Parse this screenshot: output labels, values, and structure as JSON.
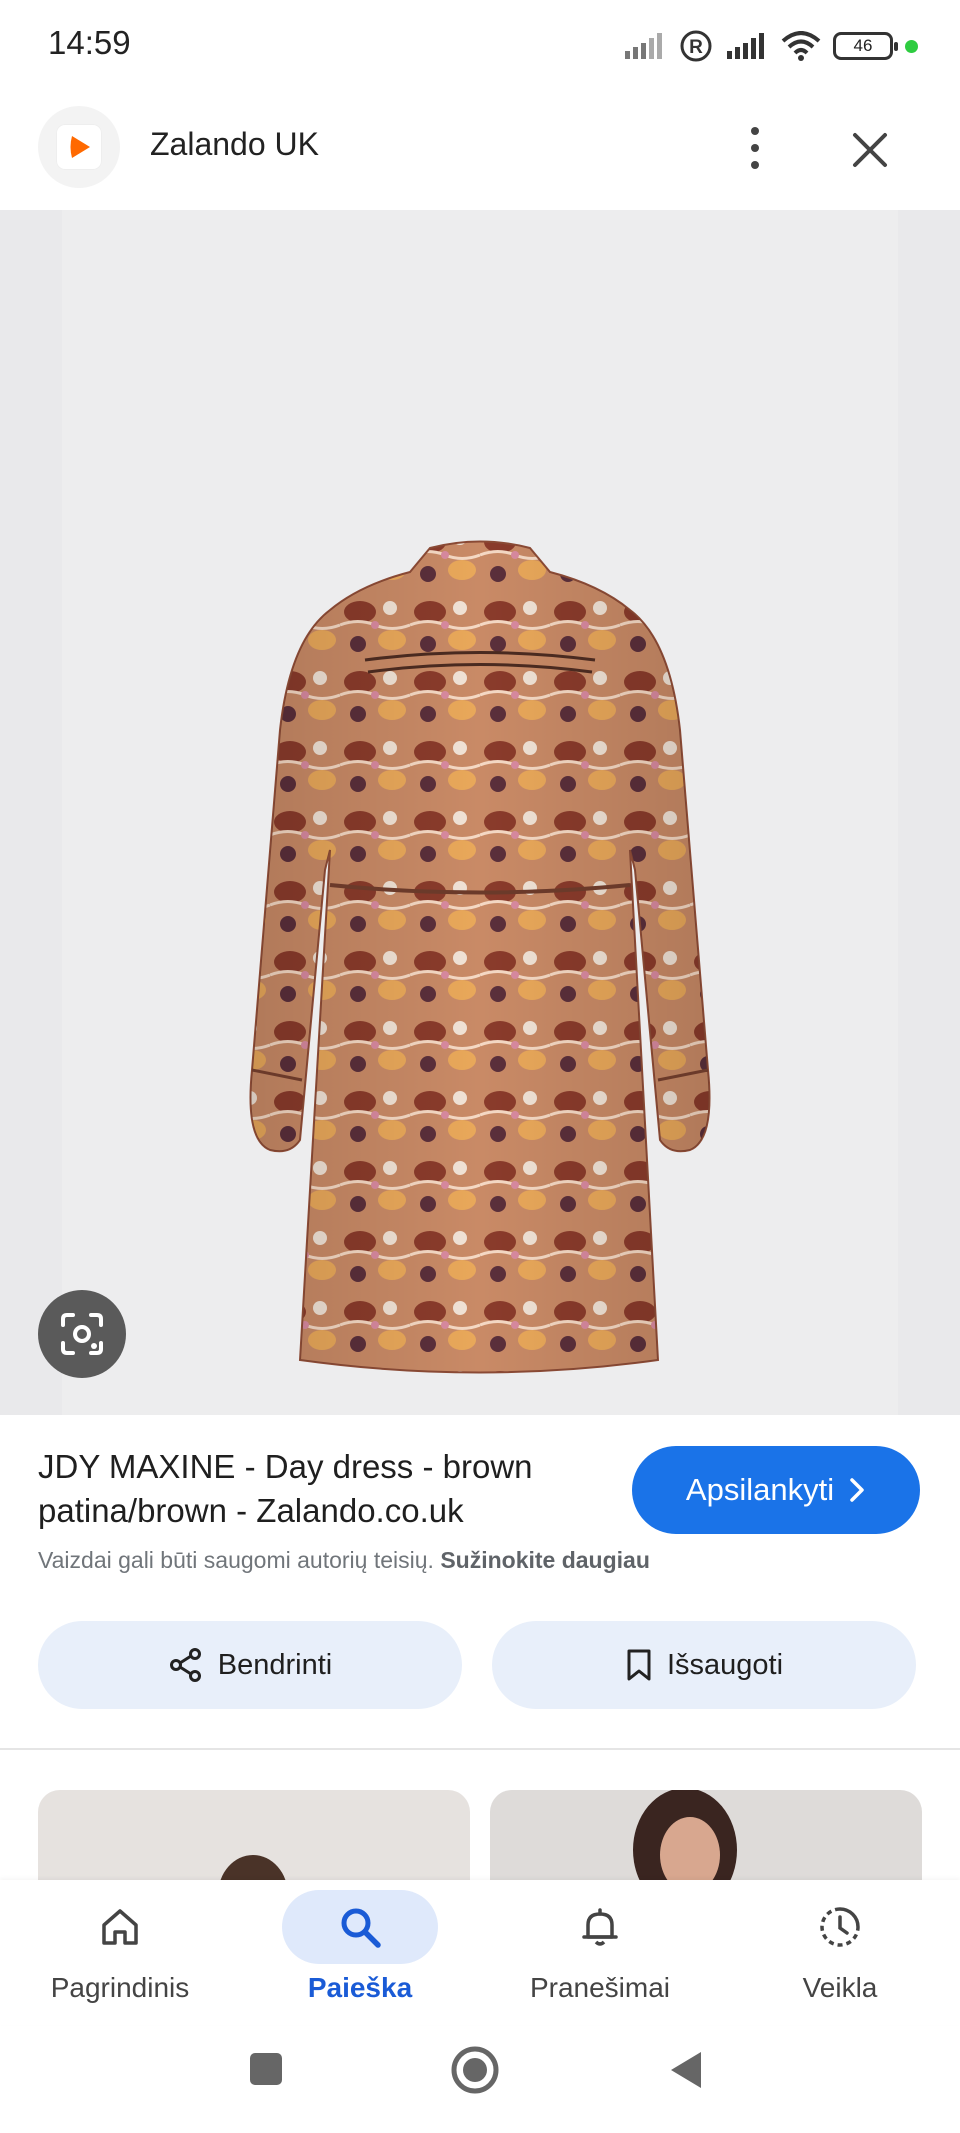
{
  "status_bar": {
    "time": "14:59",
    "battery_level": "46",
    "icons": [
      "signal-icon",
      "roaming-icon",
      "signal-icon",
      "wifi-icon",
      "battery-icon",
      "privacy-dot-icon"
    ]
  },
  "header": {
    "site_name": "Zalando UK",
    "logo_icon": "zalando-logo-icon",
    "menu_icon": "more-vert-icon",
    "close_icon": "close-icon"
  },
  "image": {
    "subject": "paisley-print long-sleeve day dress",
    "lens_icon": "lens-icon"
  },
  "result": {
    "title": "JDY MAXINE - Day dress - brown patina/brown - Zalando.co.uk",
    "visit_label": "Apsilankyti",
    "copyright_text": "Vaizdai gali būti saugomi autorių teisių.",
    "learn_more_label": "Sužinokite daugiau"
  },
  "actions": {
    "share_label": "Bendrinti",
    "save_label": "Išsaugoti"
  },
  "bottom_nav": {
    "items": [
      {
        "label": "Pagrindinis",
        "icon": "home-icon",
        "active": false
      },
      {
        "label": "Paieška",
        "icon": "search-icon",
        "active": true
      },
      {
        "label": "Pranešimai",
        "icon": "bell-icon",
        "active": false
      },
      {
        "label": "Veikla",
        "icon": "activity-icon",
        "active": false
      }
    ]
  },
  "colors": {
    "accent": "#1a73e8",
    "pill_bg": "#e8effa",
    "logo_orange": "#ff6900"
  }
}
